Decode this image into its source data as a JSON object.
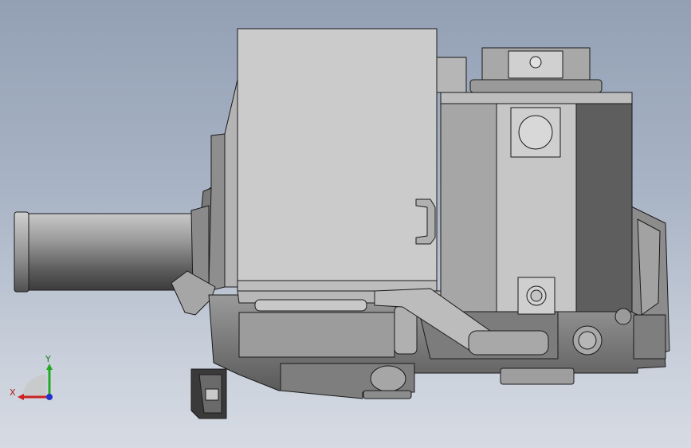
{
  "viewport": {
    "background_top": "#93a0b4",
    "background_bottom": "#d6dbe3"
  },
  "triad": {
    "x_label": "X",
    "y_label": "Y",
    "x_color": "#cc2222",
    "y_color": "#22aa22",
    "z_color": "#2233cc"
  },
  "model": {
    "icon": "cad-assembly-part",
    "edge_color": "#1a1a1a",
    "face_light": "#d2d2d2",
    "face_mid": "#a8a8a8",
    "face_dark": "#5e5e5e"
  }
}
